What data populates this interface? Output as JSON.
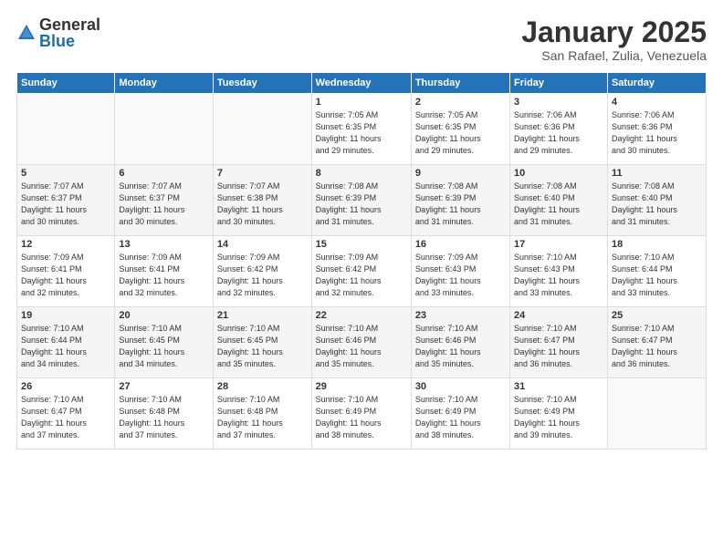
{
  "header": {
    "logo_general": "General",
    "logo_blue": "Blue",
    "month_title": "January 2025",
    "location": "San Rafael, Zulia, Venezuela"
  },
  "days_of_week": [
    "Sunday",
    "Monday",
    "Tuesday",
    "Wednesday",
    "Thursday",
    "Friday",
    "Saturday"
  ],
  "weeks": [
    {
      "shaded": false,
      "days": [
        {
          "num": "",
          "info": ""
        },
        {
          "num": "",
          "info": ""
        },
        {
          "num": "",
          "info": ""
        },
        {
          "num": "1",
          "info": "Sunrise: 7:05 AM\nSunset: 6:35 PM\nDaylight: 11 hours\nand 29 minutes."
        },
        {
          "num": "2",
          "info": "Sunrise: 7:05 AM\nSunset: 6:35 PM\nDaylight: 11 hours\nand 29 minutes."
        },
        {
          "num": "3",
          "info": "Sunrise: 7:06 AM\nSunset: 6:36 PM\nDaylight: 11 hours\nand 29 minutes."
        },
        {
          "num": "4",
          "info": "Sunrise: 7:06 AM\nSunset: 6:36 PM\nDaylight: 11 hours\nand 30 minutes."
        }
      ]
    },
    {
      "shaded": true,
      "days": [
        {
          "num": "5",
          "info": "Sunrise: 7:07 AM\nSunset: 6:37 PM\nDaylight: 11 hours\nand 30 minutes."
        },
        {
          "num": "6",
          "info": "Sunrise: 7:07 AM\nSunset: 6:37 PM\nDaylight: 11 hours\nand 30 minutes."
        },
        {
          "num": "7",
          "info": "Sunrise: 7:07 AM\nSunset: 6:38 PM\nDaylight: 11 hours\nand 30 minutes."
        },
        {
          "num": "8",
          "info": "Sunrise: 7:08 AM\nSunset: 6:39 PM\nDaylight: 11 hours\nand 31 minutes."
        },
        {
          "num": "9",
          "info": "Sunrise: 7:08 AM\nSunset: 6:39 PM\nDaylight: 11 hours\nand 31 minutes."
        },
        {
          "num": "10",
          "info": "Sunrise: 7:08 AM\nSunset: 6:40 PM\nDaylight: 11 hours\nand 31 minutes."
        },
        {
          "num": "11",
          "info": "Sunrise: 7:08 AM\nSunset: 6:40 PM\nDaylight: 11 hours\nand 31 minutes."
        }
      ]
    },
    {
      "shaded": false,
      "days": [
        {
          "num": "12",
          "info": "Sunrise: 7:09 AM\nSunset: 6:41 PM\nDaylight: 11 hours\nand 32 minutes."
        },
        {
          "num": "13",
          "info": "Sunrise: 7:09 AM\nSunset: 6:41 PM\nDaylight: 11 hours\nand 32 minutes."
        },
        {
          "num": "14",
          "info": "Sunrise: 7:09 AM\nSunset: 6:42 PM\nDaylight: 11 hours\nand 32 minutes."
        },
        {
          "num": "15",
          "info": "Sunrise: 7:09 AM\nSunset: 6:42 PM\nDaylight: 11 hours\nand 32 minutes."
        },
        {
          "num": "16",
          "info": "Sunrise: 7:09 AM\nSunset: 6:43 PM\nDaylight: 11 hours\nand 33 minutes."
        },
        {
          "num": "17",
          "info": "Sunrise: 7:10 AM\nSunset: 6:43 PM\nDaylight: 11 hours\nand 33 minutes."
        },
        {
          "num": "18",
          "info": "Sunrise: 7:10 AM\nSunset: 6:44 PM\nDaylight: 11 hours\nand 33 minutes."
        }
      ]
    },
    {
      "shaded": true,
      "days": [
        {
          "num": "19",
          "info": "Sunrise: 7:10 AM\nSunset: 6:44 PM\nDaylight: 11 hours\nand 34 minutes."
        },
        {
          "num": "20",
          "info": "Sunrise: 7:10 AM\nSunset: 6:45 PM\nDaylight: 11 hours\nand 34 minutes."
        },
        {
          "num": "21",
          "info": "Sunrise: 7:10 AM\nSunset: 6:45 PM\nDaylight: 11 hours\nand 35 minutes."
        },
        {
          "num": "22",
          "info": "Sunrise: 7:10 AM\nSunset: 6:46 PM\nDaylight: 11 hours\nand 35 minutes."
        },
        {
          "num": "23",
          "info": "Sunrise: 7:10 AM\nSunset: 6:46 PM\nDaylight: 11 hours\nand 35 minutes."
        },
        {
          "num": "24",
          "info": "Sunrise: 7:10 AM\nSunset: 6:47 PM\nDaylight: 11 hours\nand 36 minutes."
        },
        {
          "num": "25",
          "info": "Sunrise: 7:10 AM\nSunset: 6:47 PM\nDaylight: 11 hours\nand 36 minutes."
        }
      ]
    },
    {
      "shaded": false,
      "days": [
        {
          "num": "26",
          "info": "Sunrise: 7:10 AM\nSunset: 6:47 PM\nDaylight: 11 hours\nand 37 minutes."
        },
        {
          "num": "27",
          "info": "Sunrise: 7:10 AM\nSunset: 6:48 PM\nDaylight: 11 hours\nand 37 minutes."
        },
        {
          "num": "28",
          "info": "Sunrise: 7:10 AM\nSunset: 6:48 PM\nDaylight: 11 hours\nand 37 minutes."
        },
        {
          "num": "29",
          "info": "Sunrise: 7:10 AM\nSunset: 6:49 PM\nDaylight: 11 hours\nand 38 minutes."
        },
        {
          "num": "30",
          "info": "Sunrise: 7:10 AM\nSunset: 6:49 PM\nDaylight: 11 hours\nand 38 minutes."
        },
        {
          "num": "31",
          "info": "Sunrise: 7:10 AM\nSunset: 6:49 PM\nDaylight: 11 hours\nand 39 minutes."
        },
        {
          "num": "",
          "info": ""
        }
      ]
    }
  ]
}
